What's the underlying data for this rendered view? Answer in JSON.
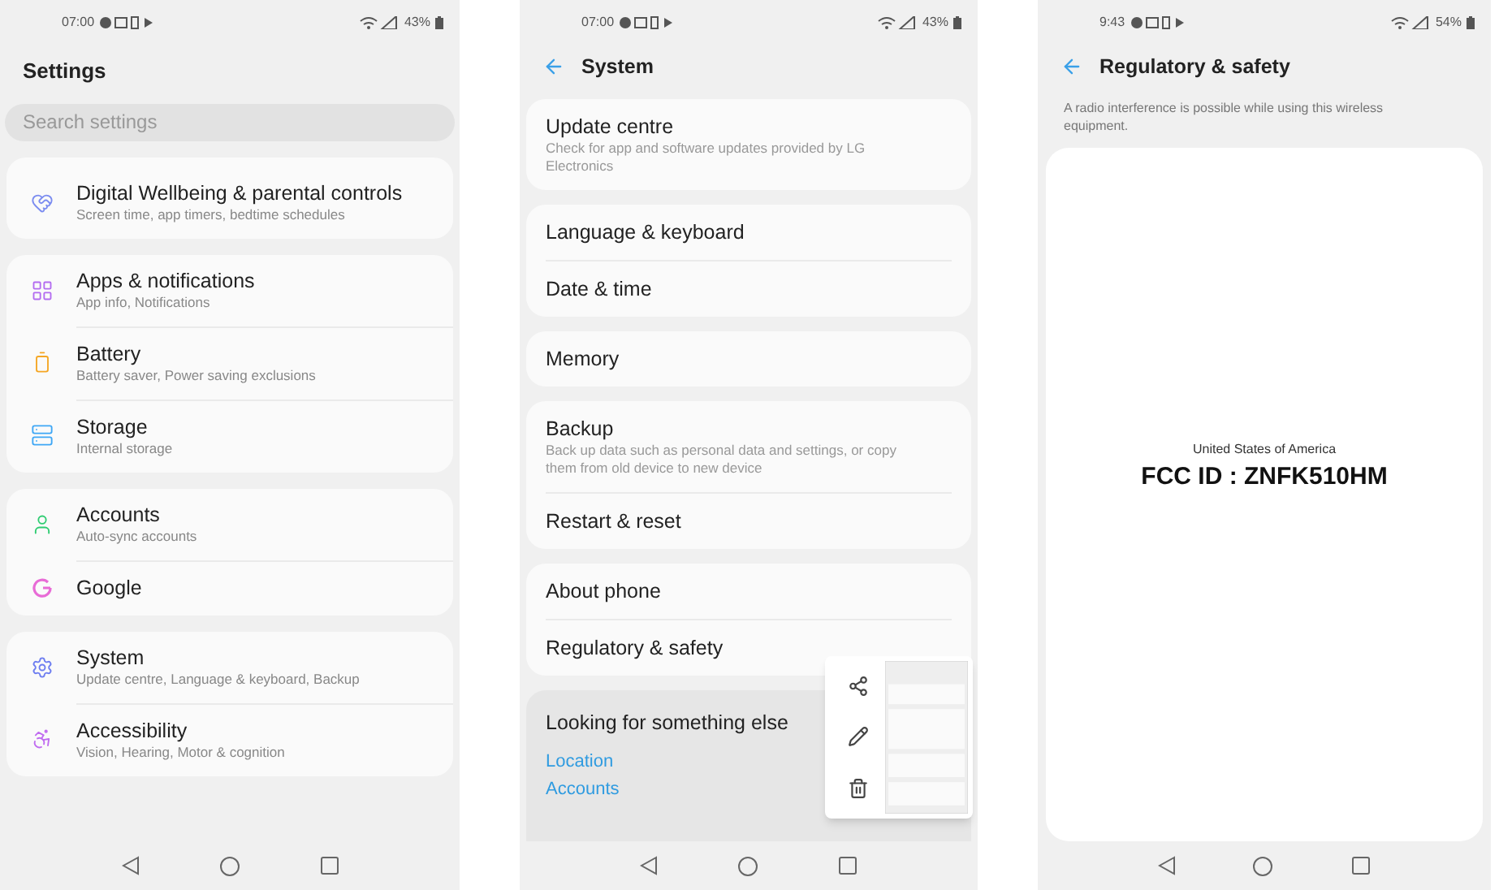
{
  "screens": [
    {
      "kind": "settings",
      "status_bar": {
        "time": "07:00",
        "battery": "43%"
      },
      "title": "Settings",
      "search": {
        "placeholder": "Search settings"
      },
      "groups": [
        [
          {
            "kind": "wellbeing",
            "color": "#7b8cf0",
            "title": "Digital Wellbeing & parental controls",
            "subtitle": "Screen time, app timers, bedtime schedules"
          }
        ],
        [
          {
            "kind": "apps",
            "color": "#b36cf0",
            "title": "Apps & notifications",
            "subtitle": "App info, Notifications"
          },
          {
            "kind": "battery",
            "color": "#f5a623",
            "title": "Battery",
            "subtitle": "Battery saver, Power saving exclusions"
          },
          {
            "kind": "storage",
            "color": "#3fa7f5",
            "title": "Storage",
            "subtitle": "Internal storage"
          }
        ],
        [
          {
            "kind": "accounts",
            "color": "#2ecc71",
            "title": "Accounts",
            "subtitle": "Auto-sync accounts"
          },
          {
            "kind": "google",
            "color": "#e86bd6",
            "title": "Google"
          }
        ],
        [
          {
            "kind": "system",
            "color": "#6d7df0",
            "title": "System",
            "subtitle": "Update centre, Language & keyboard, Backup"
          },
          {
            "kind": "accessibility",
            "color": "#c06cf0",
            "title": "Accessibility",
            "subtitle": "Vision, Hearing, Motor & cognition"
          }
        ]
      ]
    },
    {
      "kind": "system",
      "status_bar": {
        "time": "07:00",
        "battery": "43%"
      },
      "title": "System",
      "groups": [
        [
          {
            "title": "Update centre",
            "subtitle": "Check for app and software updates provided by LG Electronics"
          }
        ],
        [
          {
            "title": "Language & keyboard"
          },
          {
            "title": "Date & time"
          }
        ],
        [
          {
            "title": "Memory"
          }
        ],
        [
          {
            "title": "Backup",
            "subtitle": "Back up data such as personal data and settings, or copy them from old device to new device"
          },
          {
            "title": "Restart & reset"
          }
        ],
        [
          {
            "title": "About phone"
          },
          {
            "title": "Regulatory & safety"
          }
        ]
      ],
      "footer": {
        "title": "Looking for something else",
        "links": [
          "Location",
          "Accounts"
        ]
      }
    },
    {
      "kind": "regulatory",
      "status_bar": {
        "time": "9:43",
        "battery": "54%"
      },
      "title": "Regulatory & safety",
      "note": "A radio interference is possible while using this wireless equipment.",
      "country": "United States of America",
      "fcc_id": "FCC ID : ZNFK510HM"
    }
  ]
}
